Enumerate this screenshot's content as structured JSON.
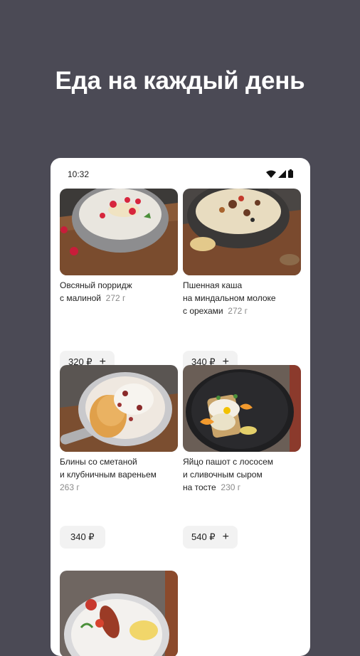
{
  "headline": "Еда на каждый день",
  "status": {
    "time": "10:32"
  },
  "items": [
    {
      "name_l1": "Овсяный порридж",
      "name_l2": "с малиной",
      "name_l3": "",
      "weight": "272 г",
      "price": "320 ₽",
      "add_icon": "+"
    },
    {
      "name_l1": "Пшенная каша",
      "name_l2": "на миндальном молоке",
      "name_l3": "с орехами",
      "weight": "272 г",
      "price": "340 ₽",
      "add_icon": "+"
    },
    {
      "name_l1": "Блины со сметаной",
      "name_l2": "и клубничным вареньем",
      "name_l3": "",
      "weight": "263 г",
      "price": "340 ₽",
      "add_icon": ""
    },
    {
      "name_l1": "Яйцо пашот с лососем",
      "name_l2": "и сливочным сыром",
      "name_l3": "на тосте",
      "weight": "230 г",
      "price": "540 ₽",
      "add_icon": "+"
    }
  ],
  "icons": [
    "wifi-icon",
    "cell-signal-icon",
    "battery-icon",
    "plus-icon"
  ],
  "colors": {
    "background": "#4b4a55",
    "card": "#ffffff",
    "price_button": "#f2f2f2"
  }
}
